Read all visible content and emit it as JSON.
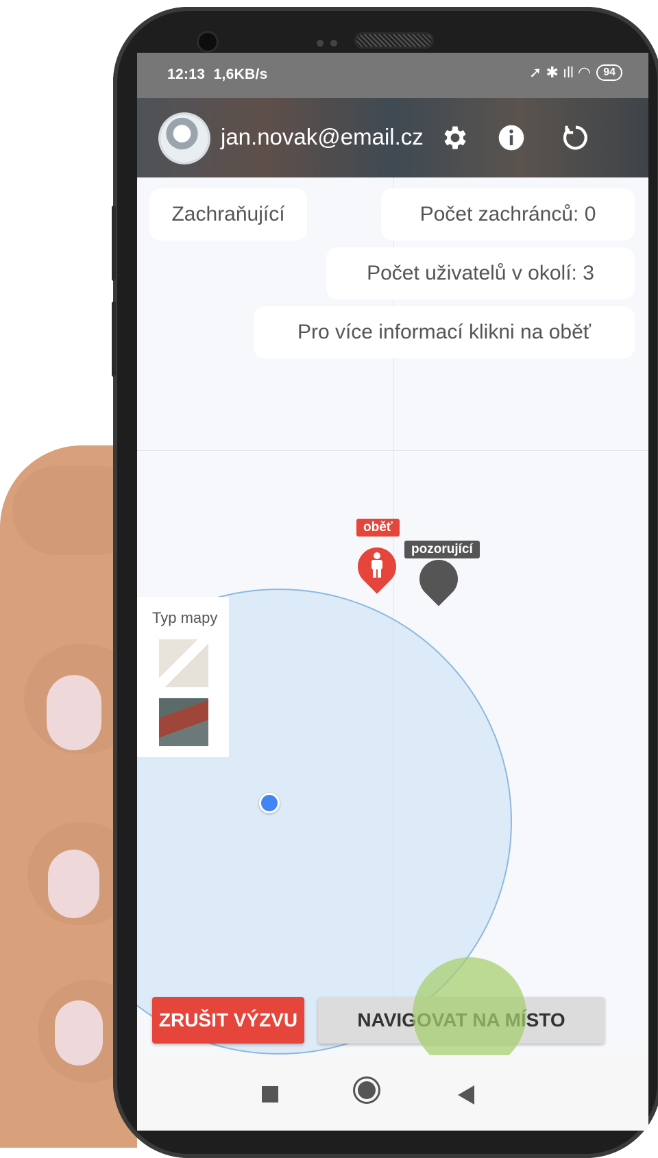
{
  "statusbar": {
    "time": "12:13",
    "speed": "1,6KB/s",
    "icons": "➚ ✱ ıll ◠",
    "battery": "94"
  },
  "header": {
    "email": "jan.novak@email.cz",
    "icons": [
      "gear-icon",
      "info-icon",
      "refresh-icon"
    ]
  },
  "chips": {
    "role": "Zachraňující",
    "rescuers": "Počet zachránců: 0",
    "users": "Počet uživatelů v okolí: 3",
    "hint": "Pro více informací klikni na oběť"
  },
  "map": {
    "type_label": "Typ mapy",
    "victim_label": "oběť",
    "observer_label": "pozorující",
    "victim_color": "#e5453a",
    "observer_color": "#555555",
    "radius_color": "#bfdbf3",
    "location_dot_color": "#4285f4"
  },
  "actions": {
    "cancel": "ZRUŠIT VÝZVU",
    "navigate": "NAVIGOVAT NA MÍSTO"
  },
  "navbar": {
    "icons": [
      "recents-icon",
      "home-icon",
      "back-icon"
    ]
  }
}
